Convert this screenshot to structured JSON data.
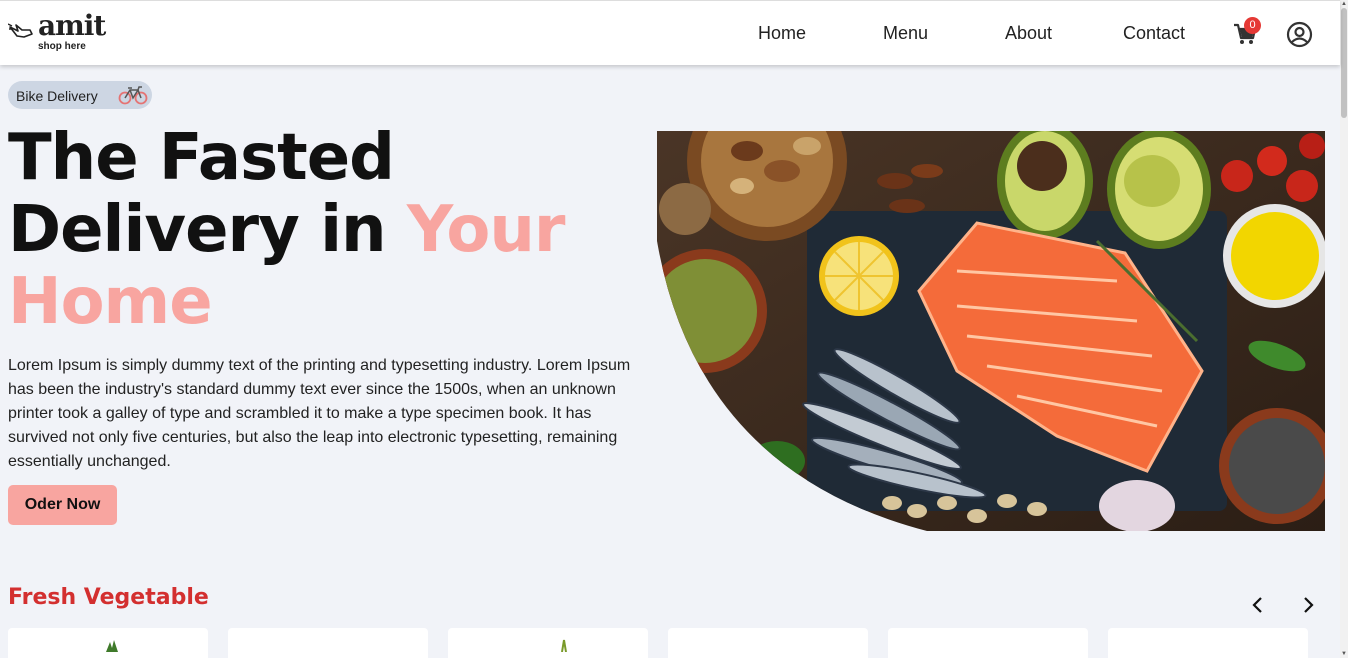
{
  "brand": {
    "name": "amit",
    "tagline": "shop here"
  },
  "nav": {
    "items": [
      {
        "label": "Home"
      },
      {
        "label": "Menu"
      },
      {
        "label": "About"
      },
      {
        "label": "Contact"
      }
    ],
    "cart_count": "0"
  },
  "hero": {
    "badge": "Bike Delivery",
    "title_part1": "The Fasted Delivery in ",
    "title_accent": "Your Home",
    "description": "Lorem Ipsum is simply dummy text of the printing and typesetting industry. Lorem Ipsum has been the industry's standard dummy text ever since the 1500s, when an unknown printer took a galley of type and scrambled it to make a type specimen book. It has survived not only five centuries, but also the leap into electronic typesetting, remaining essentially unchanged.",
    "cta": "Oder Now"
  },
  "section": {
    "title": "Fresh Vegetable"
  },
  "colors": {
    "accent": "#f8a5a0",
    "section_title": "#d32f2f",
    "badge_bg": "#cdd6e3",
    "page_bg": "#f1f3f8",
    "cart_badge": "#e53935"
  }
}
